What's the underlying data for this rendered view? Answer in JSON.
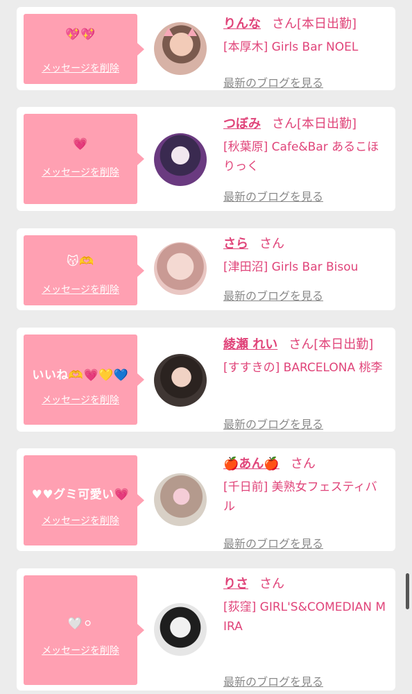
{
  "ui": {
    "delete_label": "メッセージを削除",
    "blog_label": "最新のブログを見る",
    "san": "さん",
    "accent_color": "#e0457a",
    "bubble_color": "#ffa0b2"
  },
  "entries": [
    {
      "message": "💖💖",
      "name": "りんな",
      "status": "[本日出勤]",
      "shop": "[本厚木] Girls Bar NOEL",
      "avatar_icon": "photo-avatar-icon"
    },
    {
      "message": "💗",
      "name": "つぼみ",
      "status": "[本日出勤]",
      "shop": "[秋葉原] Cafe&Bar あるこほりっく",
      "avatar_icon": "photo-avatar-icon"
    },
    {
      "message": "😽🫶",
      "name": "さら",
      "status": "",
      "shop": "[津田沼] Girls Bar Bisou",
      "avatar_icon": "photo-avatar-icon"
    },
    {
      "message": "いいね🫶💗💛💙",
      "name": "綾瀬 れい",
      "status": "[本日出勤]",
      "shop": "[すすきの] BARCELONA 桃李",
      "avatar_icon": "photo-avatar-icon"
    },
    {
      "message": "♥♥グミ可愛い💗",
      "name": "🍎あん🍎",
      "status": "",
      "shop": "[千日前] 美熟女フェスティバル",
      "avatar_icon": "photo-avatar-icon"
    },
    {
      "message": "🤍⚪",
      "name": "りさ",
      "status": "",
      "shop": "[荻窪] GIRL'S&COMEDIAN MIRA",
      "avatar_icon": "photo-avatar-icon"
    }
  ]
}
